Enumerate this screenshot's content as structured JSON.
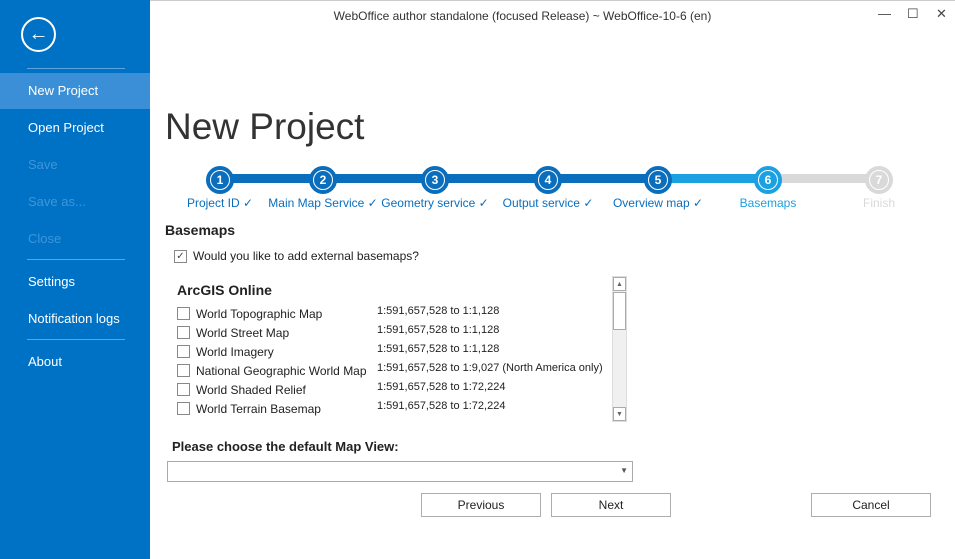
{
  "window": {
    "title": "WebOffice author standalone (focused Release) ~ WebOffice-10-6 (en)",
    "minimize": "—",
    "maximize": "☐",
    "close": "✕"
  },
  "sidebar": {
    "back": "←",
    "items": [
      {
        "label": "New Project"
      },
      {
        "label": "Open Project"
      },
      {
        "label": "Save"
      },
      {
        "label": "Save as..."
      },
      {
        "label": "Close"
      },
      {
        "label": "Settings"
      },
      {
        "label": "Notification logs"
      },
      {
        "label": "About"
      }
    ]
  },
  "page_title": "New Project",
  "steps": [
    {
      "n": "1",
      "label": "Project ID ✓"
    },
    {
      "n": "2",
      "label": "Main Map Service ✓"
    },
    {
      "n": "3",
      "label": "Geometry service ✓"
    },
    {
      "n": "4",
      "label": "Output service ✓"
    },
    {
      "n": "5",
      "label": "Overview map ✓"
    },
    {
      "n": "6",
      "label": "Basemaps"
    },
    {
      "n": "7",
      "label": "Finish"
    }
  ],
  "colors": {
    "done": "#0a6ebd",
    "current": "#1ba1e2",
    "pending": "#d9d9d9"
  },
  "basemaps": {
    "heading": "Basemaps",
    "question": "Would you like to add external basemaps?",
    "question_checked": "✓",
    "group": "ArcGIS Online",
    "items": [
      {
        "name": "World Topographic Map",
        "scale": "1:591,657,528 to 1:1,128"
      },
      {
        "name": "World Street Map",
        "scale": "1:591,657,528 to 1:1,128"
      },
      {
        "name": "World Imagery",
        "scale": "1:591,657,528 to 1:1,128"
      },
      {
        "name": "National Geographic World Map",
        "scale": "1:591,657,528 to 1:9,027 (North America only)"
      },
      {
        "name": "World Shaded Relief",
        "scale": "1:591,657,528 to 1:72,224"
      },
      {
        "name": "World Terrain Basemap",
        "scale": "1:591,657,528 to 1:72,224"
      }
    ]
  },
  "map_view": {
    "label": "Please choose the default Map View:",
    "value": ""
  },
  "buttons": {
    "previous": "Previous",
    "next": "Next",
    "cancel": "Cancel"
  }
}
